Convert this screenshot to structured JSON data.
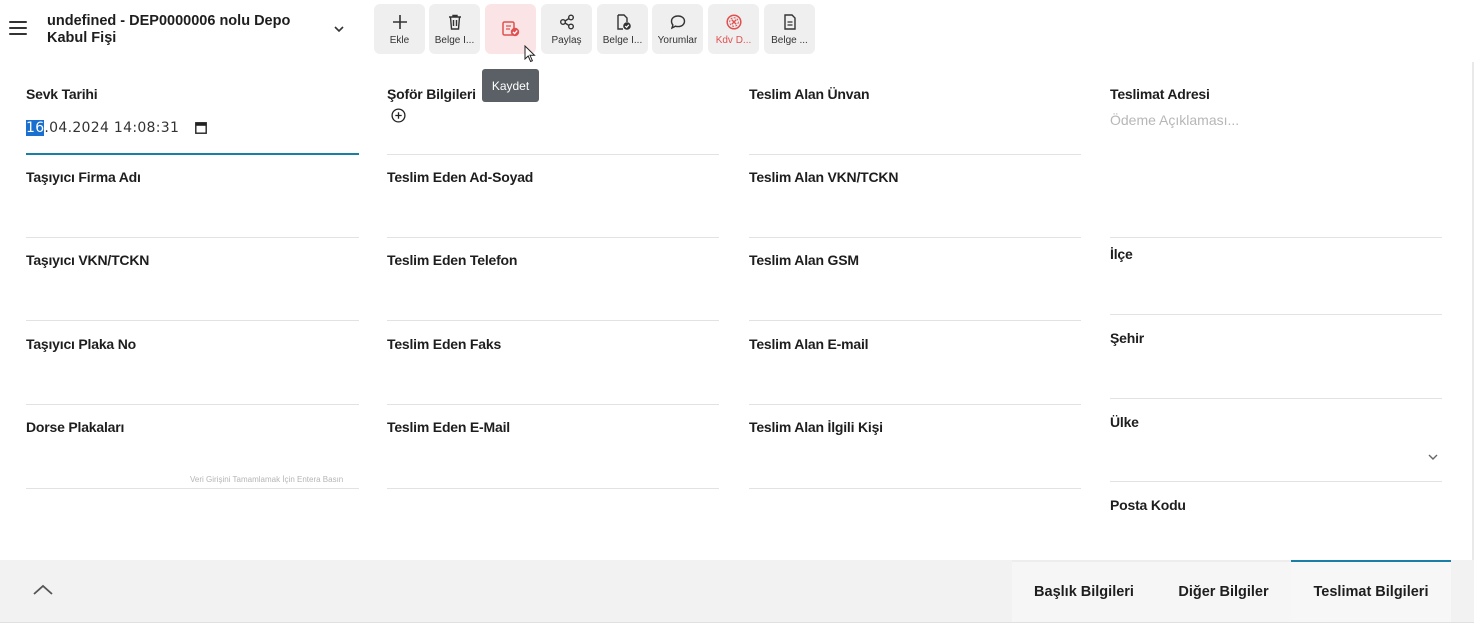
{
  "header": {
    "title": "undefined - DEP0000006 nolu Depo Kabul Fişi",
    "toolbar": [
      {
        "label": "Ekle",
        "icon": "plus-icon"
      },
      {
        "label": "Belge İ...",
        "icon": "trash-icon"
      },
      {
        "label": "",
        "icon": "save-document-icon"
      },
      {
        "label": "Paylaş",
        "icon": "share-icon"
      },
      {
        "label": "Belge İ...",
        "icon": "document-check-icon"
      },
      {
        "label": "Yorumlar",
        "icon": "comment-icon"
      },
      {
        "label": "Kdv D...",
        "icon": "cancel-circle-icon"
      },
      {
        "label": "Belge ...",
        "icon": "document-icon"
      }
    ],
    "tooltip": "Kaydet"
  },
  "form": {
    "col1": {
      "sevk_tarihi": {
        "label": "Sevk Tarihi",
        "value_selected": "16",
        "value_rest": ".04.2024 14:08:31"
      },
      "tasiyici_firma": {
        "label": "Taşıyıcı Firma Adı"
      },
      "tasiyici_vkn": {
        "label": "Taşıyıcı VKN/TCKN"
      },
      "tasiyici_plaka": {
        "label": "Taşıyıcı Plaka No"
      },
      "dorse": {
        "label": "Dorse Plakaları",
        "hint": "Veri Girişini Tamamlamak İçin Entera Basın"
      }
    },
    "col2": {
      "sofor": {
        "label": "Şoför Bilgileri"
      },
      "teslim_eden_ad": {
        "label": "Teslim Eden Ad-Soyad"
      },
      "teslim_eden_tel": {
        "label": "Teslim Eden Telefon"
      },
      "teslim_eden_faks": {
        "label": "Teslim Eden Faks"
      },
      "teslim_eden_mail": {
        "label": "Teslim Eden E-Mail"
      }
    },
    "col3": {
      "teslim_alan_unvan": {
        "label": "Teslim Alan Ünvan"
      },
      "teslim_alan_vkn": {
        "label": "Teslim Alan VKN/TCKN"
      },
      "teslim_alan_gsm": {
        "label": "Teslim Alan GSM"
      },
      "teslim_alan_email": {
        "label": "Teslim Alan E-mail"
      },
      "teslim_alan_ilgili": {
        "label": "Teslim Alan İlgili Kişi"
      }
    },
    "col4": {
      "teslimat_adresi": {
        "label": "Teslimat Adresi",
        "placeholder": "Ödeme Açıklaması..."
      },
      "ilce": {
        "label": "İlçe"
      },
      "sehir": {
        "label": "Şehir"
      },
      "ulke": {
        "label": "Ülke"
      },
      "posta_kodu": {
        "label": "Posta Kodu"
      }
    }
  },
  "tabs": [
    {
      "label": "Başlık Bilgileri"
    },
    {
      "label": "Diğer Bilgiler"
    },
    {
      "label": "Teslimat Bilgileri"
    }
  ],
  "colors": {
    "accent": "#1a7fa6",
    "danger": "#e05050",
    "selection": "#1a6fcf"
  }
}
